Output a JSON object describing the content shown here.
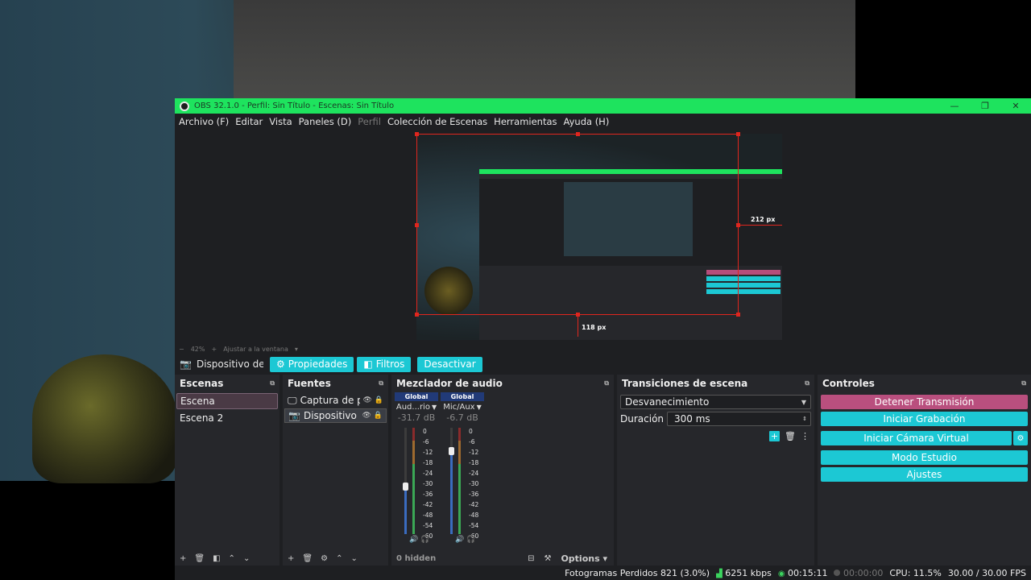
{
  "window": {
    "title": "OBS 32.1.0 - Perfil: Sin Título - Escenas: Sin Título",
    "minimize": "—",
    "maximize": "❐",
    "close": "✕"
  },
  "menu": [
    "Archivo (F)",
    "Editar",
    "Vista",
    "Paneles (D)",
    "Perfil",
    "Colección de Escenas",
    "Herramientas",
    "Ayuda (H)"
  ],
  "preview": {
    "right_label": "212 px",
    "bottom_label": "118 px",
    "zoom": "42%",
    "zoom_minus": "−",
    "zoom_plus": "+",
    "fit_label": "Ajustar a la ventana"
  },
  "source_toolbar": {
    "source_name": "Dispositivo de captura",
    "properties": "Propiedades",
    "filters": "Filtros",
    "deactivate": "Desactivar"
  },
  "scenes": {
    "title": "Escenas",
    "items": [
      "Escena",
      "Escena 2"
    ]
  },
  "sources": {
    "title": "Fuentes",
    "items": [
      "Captura de pantalla",
      "Dispositivo de captura"
    ]
  },
  "mixer": {
    "title": "Mezclador de audio",
    "channels": [
      {
        "badge": "Global",
        "name": "Aud...rio",
        "db": "-31.7 dB",
        "fader": 0.45
      },
      {
        "badge": "Global",
        "name": "Mic/Aux",
        "db": "-6.7 dB",
        "fader": 0.78
      }
    ],
    "ticks": [
      "0",
      "-6",
      "-12",
      "-18",
      "-24",
      "-30",
      "-36",
      "-42",
      "-48",
      "-54",
      "-60"
    ],
    "hidden": "0 hidden",
    "options": "Options"
  },
  "transitions": {
    "title": "Transiciones de escena",
    "selected": "Desvanecimiento",
    "duration_label": "Duración",
    "duration_value": "300 ms"
  },
  "controls": {
    "title": "Controles",
    "stop_stream": "Detener Transmisión",
    "start_recording": "Iniciar Grabación",
    "start_virtual_cam": "Iniciar Cámara Virtual",
    "studio_mode": "Modo Estudio",
    "settings": "Ajustes"
  },
  "status": {
    "dropped": "Fotogramas Perdidos 821 (3.0%)",
    "bitrate": "6251 kbps",
    "stream_time": "00:15:11",
    "rec_time": "00:00:00",
    "cpu": "CPU: 11.5%",
    "fps": "30.00 / 30.00 FPS"
  },
  "colors": {
    "title_green": "#1ee35e",
    "accent_teal": "#1cc8d4",
    "stop_pink": "#b94f7e",
    "selection_red": "#e0261e"
  }
}
